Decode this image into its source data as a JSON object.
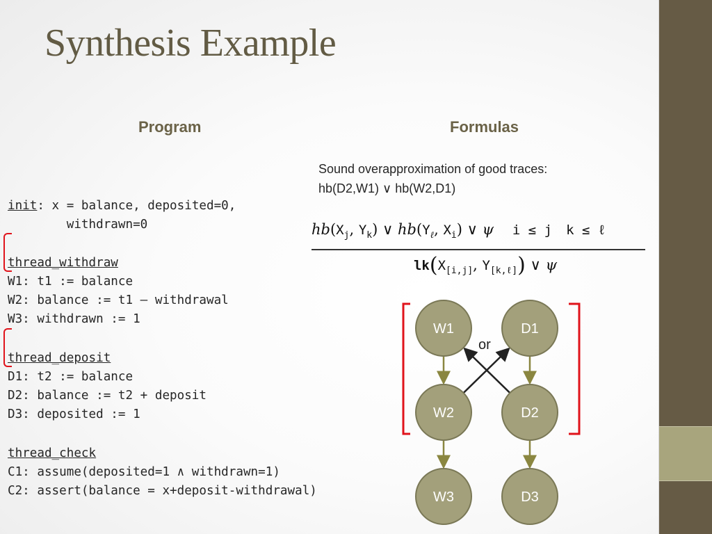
{
  "slide": {
    "title": "Synthesis Example",
    "colors": {
      "title": "#625b44",
      "sidebar": "#665b45",
      "sidebar_band": "#a8a57d",
      "node_fill": "#a3a07b",
      "node_stroke": "#7a7856",
      "edge_program_order": "#8a8640",
      "edge_hb": "#222222",
      "bracket": "#e0131b"
    }
  },
  "program": {
    "heading": "Program",
    "init_keyword": "init",
    "init_rest": ": x = balance, deposited=0,",
    "init_cont": "        withdrawn=0",
    "threads": [
      {
        "name": "thread_withdraw",
        "lines": [
          "W1: t1 := balance",
          "W2: balance := t1 – withdrawal",
          "W3: withdrawn := 1"
        ]
      },
      {
        "name": "thread_deposit",
        "lines": [
          "D1: t2 := balance",
          "D2: balance := t2 + deposit",
          "D3: deposited := 1"
        ]
      },
      {
        "name": "thread_check",
        "lines": [
          "C1: assume(deposited=1 ∧ withdrawn=1)",
          "C2: assert(balance = x+deposit-withdrawal)"
        ]
      }
    ]
  },
  "formulas": {
    "heading": "Formulas",
    "description_line1": "Sound overapproximation of good traces:",
    "description_line2": "hb(D2,W1) ∨ hb(W2,D1)",
    "rule": {
      "premise_parts": {
        "hb1": "hb",
        "x_j": "X",
        "j": "j",
        "y_k": "Y",
        "k": "k",
        "or1": "∨",
        "hb2": "hb",
        "y_l": "Y",
        "l": "ℓ",
        "x_i": "X",
        "i": "i",
        "or2": "∨",
        "psi": "ψ",
        "cond1": "i ≤ j",
        "cond2": "k ≤ ℓ"
      },
      "conclusion_parts": {
        "lk": "lk",
        "x": "X",
        "xrange": "[i,j]",
        "y": "Y",
        "yrange": "[k,ℓ]",
        "or": "∨",
        "psi": "ψ"
      }
    }
  },
  "diagram": {
    "nodes": [
      {
        "id": "W1",
        "label": "W1"
      },
      {
        "id": "D1",
        "label": "D1"
      },
      {
        "id": "W2",
        "label": "W2"
      },
      {
        "id": "D2",
        "label": "D2"
      },
      {
        "id": "W3",
        "label": "W3"
      },
      {
        "id": "D3",
        "label": "D3"
      }
    ],
    "program_order_edges": [
      [
        "W1",
        "W2"
      ],
      [
        "W2",
        "W3"
      ],
      [
        "D1",
        "D2"
      ],
      [
        "D2",
        "D3"
      ]
    ],
    "hb_edges": [
      [
        "W2",
        "D1"
      ],
      [
        "D2",
        "W1"
      ]
    ],
    "or_label": "or"
  }
}
